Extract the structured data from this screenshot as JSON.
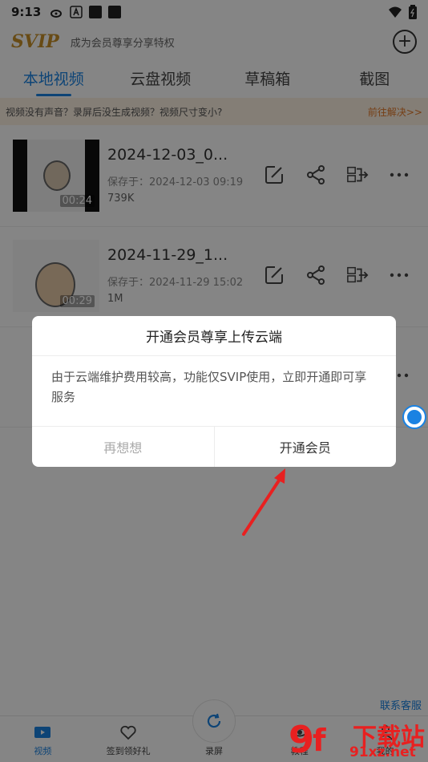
{
  "statusbar": {
    "time": "9:13"
  },
  "header": {
    "promo_text": "成为会员尊享分享特权",
    "add_label": "+"
  },
  "tabs": [
    {
      "label": "本地视频"
    },
    {
      "label": "云盘视频"
    },
    {
      "label": "草稿箱"
    },
    {
      "label": "截图"
    }
  ],
  "notice": {
    "text": "视频没有声音？录屏后没生成视频？视频尺寸变小?",
    "link": "前往解决>>"
  },
  "videos": [
    {
      "title": "2024-12-03_0...",
      "saved": "保存于：2024-12-03 09:19",
      "size": "739K",
      "duration": "00:24"
    },
    {
      "title": "2024-11-29_1...",
      "saved": "保存于：2024-11-29 15:02",
      "size": "1M",
      "duration": "00:29"
    }
  ],
  "dialog": {
    "title": "开通会员尊享上传云端",
    "body": "由于云端维护费用较高，功能仅SVIP使用，立即开通即可享服务",
    "cancel": "再想想",
    "confirm": "开通会员"
  },
  "bottom_nav": [
    {
      "label": "视频"
    },
    {
      "label": "签到领好礼"
    },
    {
      "label": "录屏"
    },
    {
      "label": "教程"
    },
    {
      "label": "我的"
    }
  ],
  "contact": "联系客服",
  "watermark": {
    "line1": "下载站",
    "line2": "91xz.net"
  },
  "colors": {
    "accent": "#1a82e2",
    "notice_bg": "#fdf1e3",
    "notice_link": "#e37a2a",
    "arrow": "#e82020"
  }
}
